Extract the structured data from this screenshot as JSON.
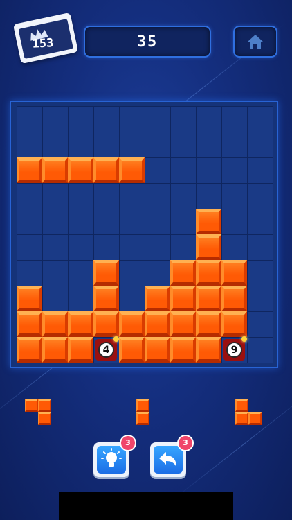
{
  "header": {
    "best_score": "153",
    "current_score": "35"
  },
  "board": {
    "rows": 10,
    "cols": 10,
    "filled_cells": [
      [
        2,
        0
      ],
      [
        2,
        1
      ],
      [
        2,
        2
      ],
      [
        2,
        3
      ],
      [
        2,
        4
      ],
      [
        4,
        7
      ],
      [
        5,
        7
      ],
      [
        6,
        3
      ],
      [
        6,
        6
      ],
      [
        6,
        7
      ],
      [
        6,
        8
      ],
      [
        7,
        0
      ],
      [
        7,
        3
      ],
      [
        7,
        5
      ],
      [
        7,
        6
      ],
      [
        7,
        7
      ],
      [
        7,
        8
      ],
      [
        8,
        0
      ],
      [
        8,
        1
      ],
      [
        8,
        2
      ],
      [
        8,
        3
      ],
      [
        8,
        4
      ],
      [
        8,
        5
      ],
      [
        8,
        6
      ],
      [
        8,
        7
      ],
      [
        8,
        8
      ],
      [
        9,
        0
      ],
      [
        9,
        1
      ],
      [
        9,
        2
      ],
      [
        9,
        4
      ],
      [
        9,
        5
      ],
      [
        9,
        6
      ],
      [
        9,
        7
      ]
    ],
    "bomb_cells": [
      {
        "row": 9,
        "col": 3,
        "count": "4"
      },
      {
        "row": 9,
        "col": 8,
        "count": "9"
      }
    ]
  },
  "pieces": [
    {
      "name": "z-piece",
      "cells": [
        [
          0,
          0
        ],
        [
          0,
          1
        ],
        [
          1,
          1
        ]
      ]
    },
    {
      "name": "vertical-domino",
      "cells": [
        [
          0,
          0
        ],
        [
          1,
          0
        ]
      ]
    },
    {
      "name": "l-piece",
      "cells": [
        [
          0,
          0
        ],
        [
          1,
          0
        ],
        [
          1,
          1
        ]
      ]
    }
  ],
  "tools": {
    "hint": {
      "icon": "lightbulb-icon",
      "count": "3"
    },
    "undo": {
      "icon": "undo-arrow-icon",
      "count": "3"
    }
  },
  "colors": {
    "block": "#ff5a05",
    "background": "#142e7e",
    "accent": "#2f6fe0",
    "badge": "#f0456a"
  }
}
